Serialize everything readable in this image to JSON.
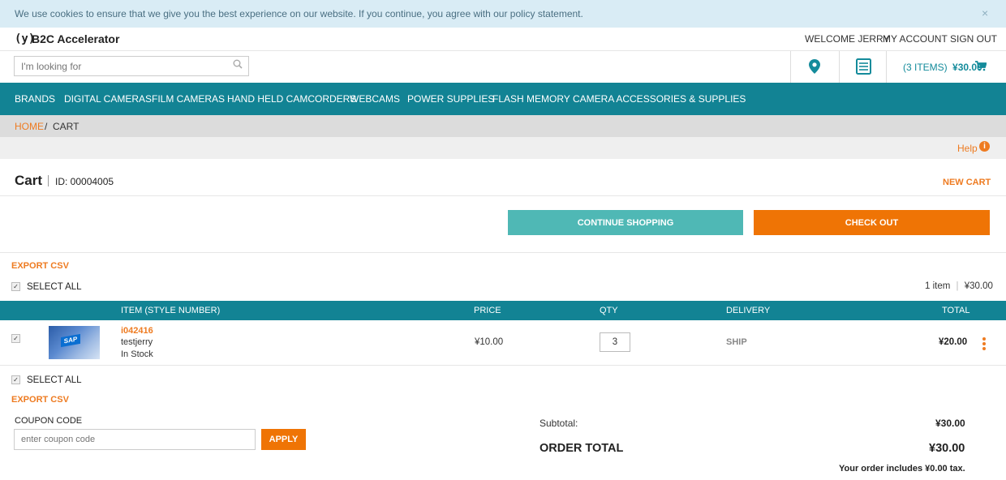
{
  "cookie": {
    "text": "We use cookies to ensure that we give you the best experience on our website. If you continue, you agree with our policy statement.",
    "close": "×"
  },
  "header": {
    "logo_mark": "(y)",
    "logo_text": "B2C Accelerator",
    "welcome": "WELCOME JERRY",
    "account": "MY ACCOUNT",
    "signout": "SIGN OUT"
  },
  "search": {
    "placeholder": "I'm looking for",
    "icon": "search-icon"
  },
  "minicart": {
    "items": "(3 ITEMS)",
    "total": "¥30.00",
    "location_icon": "map-pin-icon",
    "list_icon": "list-icon",
    "cart_icon": "cart-icon"
  },
  "nav": [
    "BRANDS",
    "DIGITAL CAMERAS",
    "FILM CAMERAS",
    "HAND HELD CAMCORDERS",
    "WEBCAMS",
    "POWER SUPPLIES",
    "FLASH MEMORY",
    "CAMERA ACCESSORIES & SUPPLIES"
  ],
  "breadcrumb": {
    "home": "HOME",
    "sep": "/",
    "current": "CART"
  },
  "help": {
    "label": "Help",
    "icon": "i"
  },
  "cart": {
    "title": "Cart",
    "id": "ID: 00004005",
    "new_cart": "NEW CART"
  },
  "actions": {
    "continue": "CONTINUE SHOPPING",
    "checkout": "CHECK OUT"
  },
  "list": {
    "export_csv": "EXPORT CSV",
    "select_all": "SELECT ALL",
    "summary_count": "1 item",
    "summary_total": "¥30.00",
    "columns": [
      "ITEM (STYLE NUMBER)",
      "PRICE",
      "QTY",
      "DELIVERY",
      "TOTAL"
    ],
    "rows": [
      {
        "code": "i042416",
        "name": "testjerry",
        "stock": "In Stock",
        "price": "¥10.00",
        "qty": "3",
        "delivery": "SHIP",
        "total": "¥20.00",
        "image_logo": "SAP"
      }
    ]
  },
  "coupon": {
    "label": "COUPON CODE",
    "placeholder": "enter coupon code",
    "apply": "APPLY"
  },
  "totals": {
    "subtotal_label": "Subtotal:",
    "subtotal": "¥30.00",
    "order_total_label": "ORDER TOTAL",
    "order_total": "¥30.00",
    "tax_note": "Your order includes ¥0.00 tax."
  },
  "colors": {
    "teal": "#128394",
    "orange": "#ee7b21",
    "light_teal": "#4fb8b5",
    "cookie_bg": "#d9ecf5"
  }
}
